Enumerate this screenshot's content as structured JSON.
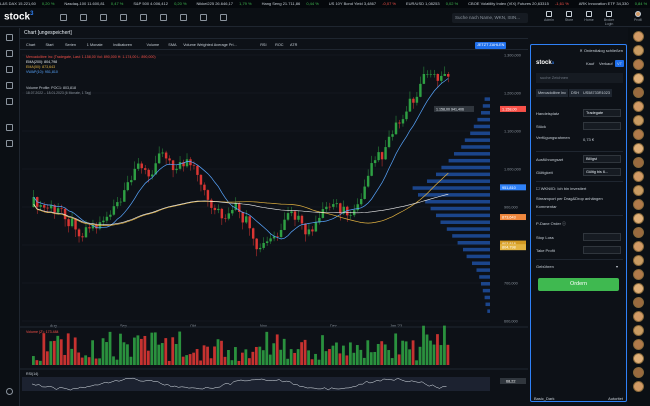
{
  "ticker": [
    {
      "name": "L&S DAX",
      "value": "15.221,60",
      "change": "0,20 %",
      "dir": "up"
    },
    {
      "name": "Nasdaq-100",
      "value": "11.600,81",
      "change": "0,47 %",
      "dir": "up"
    },
    {
      "name": "S&P 500",
      "value": "4.006,412",
      "change": "0,20 %",
      "dir": "up"
    },
    {
      "name": "Nikkei225",
      "value": "26.646,17",
      "change": "1,79 %",
      "dir": "up"
    },
    {
      "name": "Hang Seng",
      "value": "21.711,86",
      "change": "0,44 %",
      "dir": "up"
    },
    {
      "name": "US 10Y Bond Yield",
      "value": "3,4867",
      "change": "-0,07 %",
      "dir": "down"
    },
    {
      "name": "EUR/USD",
      "value": "1,08253",
      "change": "0,02 %",
      "dir": "up"
    },
    {
      "name": "CBOE Volatility Index (VIX) Futures",
      "value": "20,63315",
      "change": "-1,61 %",
      "dir": "down"
    },
    {
      "name": "ARK Innovation ETF",
      "value": "34,330",
      "change": "0,84 %",
      "dir": "up"
    },
    {
      "name": "Brent Crude Oil",
      "value": "",
      "change": "",
      "dir": "up"
    }
  ],
  "topbar": {
    "logo": "stock",
    "logo_mark": "3",
    "search_placeholder": "Suche nach Name, WKN, ISIN...",
    "nav": [
      "Admin",
      "Store",
      "Home",
      "Broker Login",
      "Profil"
    ]
  },
  "chart": {
    "title": "Chart [ungespeichert]",
    "toolbar": [
      "Chart",
      "Start",
      "Serien",
      "1 Monate",
      "Indikatoren",
      "Volume",
      "SMA",
      "Volume Weighted Average Pri...",
      "RSI",
      "ROC",
      "ATR"
    ],
    "toolbar_right": "JETZT ZAHLEN",
    "legend": [
      "Mercadolibre Inc (Tradegate, Last: 1.158,00 Vol: 890,000 H: 1.174,00 L: 890,000)",
      "EMA(200): 804,798",
      "EMA(50): 873,643",
      "VWAP(10): 951,810"
    ],
    "vp_title": "Volume Profile: POC1: 803,818",
    "vp_sub": "18.07.2022 – 18.01.2023 (6 Monate, 1 Tag)",
    "x_ticks": [
      "Aug",
      "Sep",
      "Okt",
      "Nov",
      "Dez",
      "Jan '23"
    ],
    "y_ticks": [
      "1.300,000",
      "1.200,000",
      "1.100,000",
      "1.000,000",
      "900,000",
      "800,000",
      "700,000",
      "600,000"
    ],
    "price_tags": [
      {
        "label": "1.158,00",
        "color": "#f85149"
      },
      {
        "label": "951,810",
        "color": "#2f81f7"
      },
      {
        "label": "803,818",
        "color": "#d29922"
      },
      {
        "label": "873,643",
        "color": "#f0883e"
      },
      {
        "label": "804,798",
        "color": "#e3b341"
      }
    ],
    "current_label": "1.158,00  941,406",
    "volume_label": "Volume (Z): 173.484",
    "rsi_label": "RSI(14)",
    "rsi_value": "68,22"
  },
  "panel": {
    "close_label": "Orderdialog schließen",
    "logo": "stock",
    "tabs": [
      "Kauf",
      "Verkauf",
      "VT"
    ],
    "search": "suche Zeichnen",
    "chips": [
      "Mercadolibre Inc",
      "DSH",
      "US58733R1023"
    ],
    "fields": [
      {
        "label": "Handelsplatz",
        "value": "Tradegate"
      },
      {
        "label": "Stück",
        "value": ""
      },
      {
        "label": "Verfügungsrahmen",
        "value": "0,73 €"
      },
      {
        "label": "Ausführungsart",
        "value": "Billigst"
      },
      {
        "label": "Gültigkeit",
        "value": "Gültig bis 6..."
      }
    ],
    "hinweis": "WKN/ID: Ich bin investiert",
    "streamport": "Streamport per Drag&Drop anhängen",
    "kommentar": "Kommentar",
    "p_order": "P-Dane Order",
    "stop_loss": "Stop Loss",
    "take_profit": "Take Profit",
    "gebuehren": "Gebühren",
    "order_button": "Ordern",
    "bottom_left": "Basic_Dark",
    "bottom_right": "Autoritet"
  },
  "chart_data": {
    "type": "candlestick",
    "x": [
      "Aug",
      "Sep",
      "Okt",
      "Nov",
      "Dez",
      "Jan '23"
    ],
    "price_range": [
      600,
      1300
    ]
  }
}
